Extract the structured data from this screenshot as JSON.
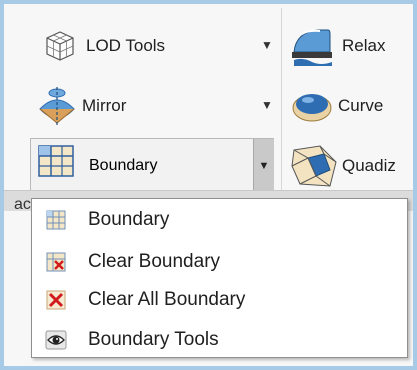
{
  "ribbon": {
    "lod_tools": {
      "label": "LOD Tools",
      "arrow": "▼"
    },
    "mirror": {
      "label": "Mirror",
      "arrow": "▼"
    },
    "boundary": {
      "label": "Boundary",
      "arrow": "▼"
    },
    "relax": {
      "label": "Relax"
    },
    "curve": {
      "label": "Curve"
    },
    "quadiz": {
      "label": "Quadiz"
    },
    "strip_left": "ac"
  },
  "menu": {
    "items": [
      {
        "label": "Boundary",
        "icon": "boundary-grid-icon"
      },
      {
        "label": "Clear Boundary",
        "icon": "clear-boundary-icon"
      },
      {
        "label": "Clear All Boundary",
        "icon": "clear-all-boundary-icon"
      },
      {
        "label": "Boundary Tools",
        "icon": "eye-icon"
      }
    ]
  },
  "colors": {
    "frame": "#a7cbe6",
    "split_drop": "#c9c9c9",
    "red_x": "#d01c1c",
    "blue_shape": "#2f6db3"
  }
}
